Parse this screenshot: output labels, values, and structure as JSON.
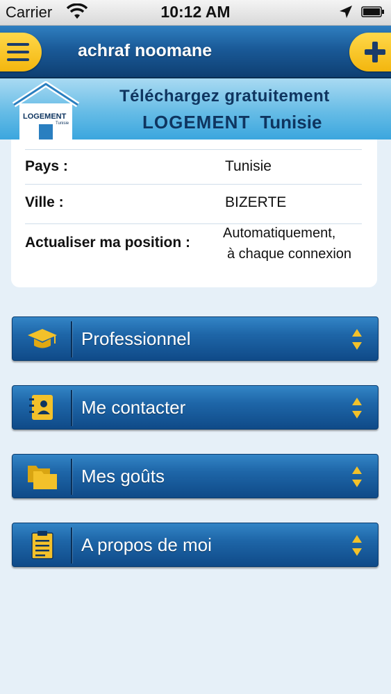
{
  "status_bar": {
    "carrier": "Carrier",
    "time": "10:12 AM"
  },
  "nav": {
    "title": "achraf noomane",
    "menu_icon": "hamburger-menu-icon",
    "add_icon": "plus-icon"
  },
  "banner": {
    "logo_text": "LOGEMENT",
    "logo_subtext": "Tunisie",
    "line1": "Téléchargez gratuitement",
    "brand": "LOGEMENT",
    "country": "Tunisie"
  },
  "info": {
    "rows": [
      {
        "label": "Pays :",
        "value": "Tunisie"
      },
      {
        "label": "Ville :",
        "value": "BIZERTE"
      },
      {
        "label": "Actualiser ma position :",
        "value_line1": "Automatiquement,",
        "value_line2": "à chaque connexion"
      }
    ]
  },
  "sections": [
    {
      "label": "Professionnel",
      "icon": "graduation-cap-icon"
    },
    {
      "label": "Me contacter",
      "icon": "address-book-icon"
    },
    {
      "label": "Mes goûts",
      "icon": "folders-icon"
    },
    {
      "label": "A propos de moi",
      "icon": "clipboard-icon"
    }
  ],
  "colors": {
    "accent_yellow": "#f3b60e",
    "nav_blue": "#1a5a98",
    "banner_blue": "#66bce6",
    "text_dark_blue": "#0f3560"
  }
}
